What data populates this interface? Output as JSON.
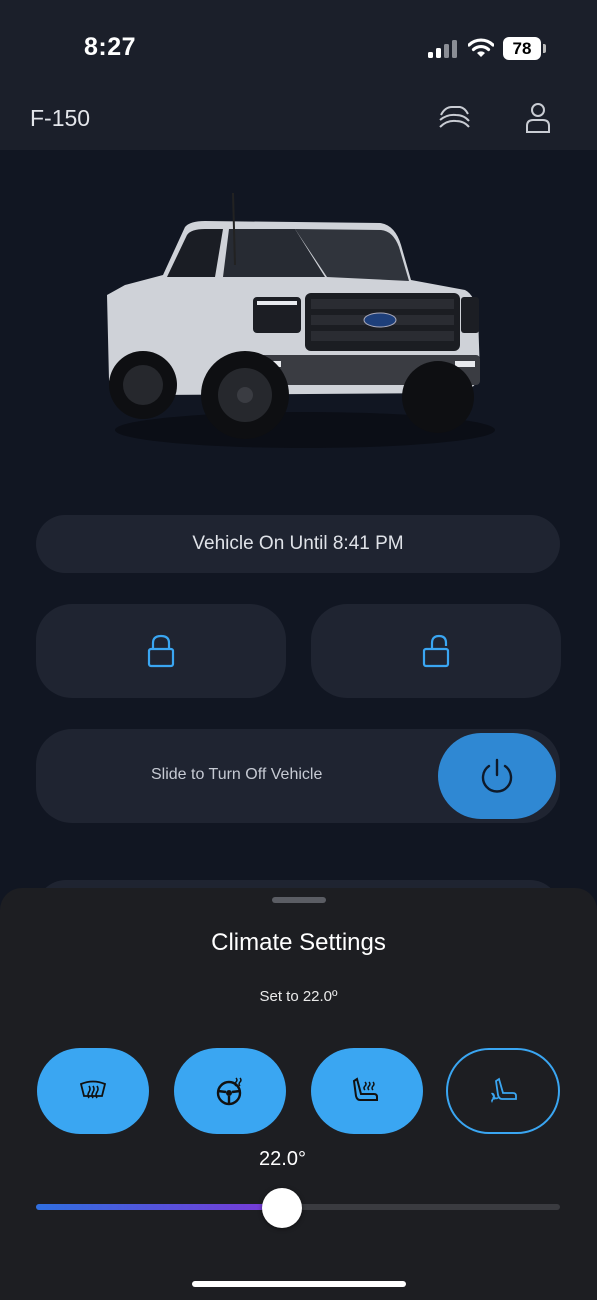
{
  "status_bar": {
    "time": "8:27",
    "battery": "78"
  },
  "header": {
    "vehicle_name": "F-150",
    "icons": [
      "vehicle-icon",
      "account-icon"
    ]
  },
  "vehicle_status": "Vehicle On Until 8:41 PM",
  "controls": {
    "lock_icon": "lock-icon",
    "unlock_icon": "unlock-icon",
    "slide_label": "Slide to Turn Off Vehicle",
    "power_icon": "power-icon"
  },
  "climate": {
    "title": "Climate Settings",
    "subtitle": "Set to 22.0º",
    "buttons": [
      {
        "icon": "rear-defrost-icon",
        "active": true
      },
      {
        "icon": "heated-steering-wheel-icon",
        "active": true
      },
      {
        "icon": "heated-seat-icon",
        "active": true
      },
      {
        "icon": "ventilated-seat-icon",
        "active": false
      }
    ],
    "temperature_label": "22.0°",
    "temperature_slider_fraction": 0.47
  },
  "colors": {
    "accent": "#3aa6f2",
    "power": "#2f88d3",
    "background": "#111622",
    "sheet": "#1d1e22"
  }
}
